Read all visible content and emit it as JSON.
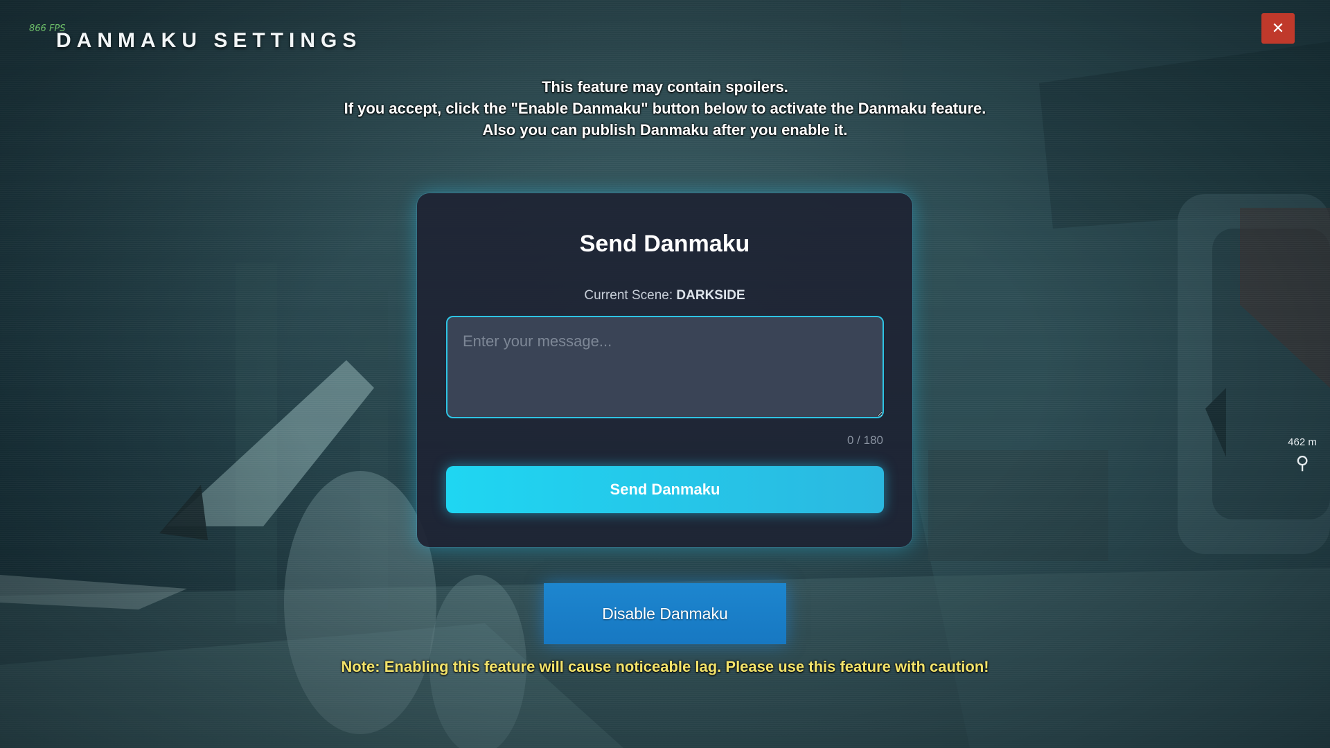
{
  "hud": {
    "fps": "866 FPS",
    "distance": "462 m",
    "pin_icon": "location-pin-icon"
  },
  "header": {
    "title": "DANMAKU SETTINGS",
    "close_icon": "close-icon",
    "close_label": "✕"
  },
  "intro": {
    "line1": "This feature may contain spoilers.",
    "line2": "If you accept, click the \"Enable Danmaku\" button below to activate the Danmaku feature.",
    "line3": "Also you can publish Danmaku after you enable it."
  },
  "panel": {
    "title": "Send Danmaku",
    "scene_label": "Current Scene:",
    "scene_name": "DARKSIDE",
    "input_placeholder": "Enter your message...",
    "input_value": "",
    "counter": "0 / 180",
    "send_label": "Send Danmaku"
  },
  "actions": {
    "disable_label": "Disable Danmaku"
  },
  "note": "Note: Enabling this feature will cause noticeable lag. Please use this feature with caution!",
  "colors": {
    "accent": "#2ec4e4",
    "close": "#c0392b",
    "note": "#f3e36a",
    "disable_button": "#1778c2"
  }
}
